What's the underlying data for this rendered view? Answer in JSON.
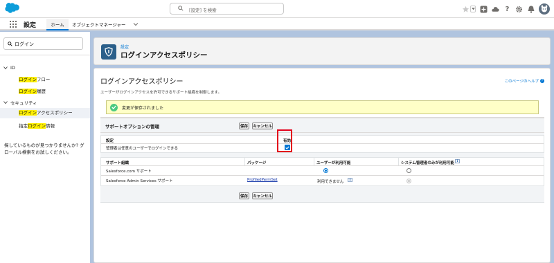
{
  "header": {
    "search_placeholder": "[設定] を検索"
  },
  "nav": {
    "app_name": "設定",
    "tab_home": "ホーム",
    "tab_object_manager": "オブジェクトマネージャー"
  },
  "sidebar": {
    "quick_find_value": "ログイン",
    "groups": [
      {
        "label": "ID",
        "items": [
          {
            "pre": "",
            "hl": "ログイン",
            "post": "フロー"
          },
          {
            "pre": "",
            "hl": "ログイン",
            "post": "履歴"
          }
        ]
      },
      {
        "label": "セキュリティ",
        "items": [
          {
            "pre": "",
            "hl": "ログイン",
            "post": "アクセスポリシー"
          },
          {
            "pre": "指定",
            "hl": "ログイン",
            "post": "情報"
          }
        ]
      }
    ],
    "not_found_text": "探しているものが見つかりませんか? グローバル検索をお試しください。"
  },
  "titlebar": {
    "breadcrumb": "設定",
    "title": "ログインアクセスポリシー"
  },
  "content": {
    "heading": "ログインアクセスポリシー",
    "help_link": "このページのヘルプ",
    "description": "ユーザーがログインアクセスを許可できるサポート組織を制御します。",
    "success_message": "変更が保存されました",
    "panel_title": "サポートオプションの管理",
    "save_label": "保存",
    "cancel_label": "キャンセル",
    "settings": {
      "col_setting": "設定",
      "col_enabled": "有効",
      "row_label": "管理者は任意のユーザーでログインできる",
      "row_checked": true
    },
    "support": {
      "headers": [
        "サポート組織",
        "パッケージ",
        "ユーザーが利用可能",
        "システム管理者のみが利用可能"
      ],
      "rows": [
        {
          "org": "Salesforce.com サポート",
          "package": "",
          "user_available": "selected",
          "user_text": "",
          "admin_only": "unselected"
        },
        {
          "org": "Salesforce Admin Services サポート",
          "package": "ProfiledPermSet",
          "user_available": "text",
          "user_text": "利用できません",
          "admin_only": "disabled"
        }
      ]
    }
  }
}
